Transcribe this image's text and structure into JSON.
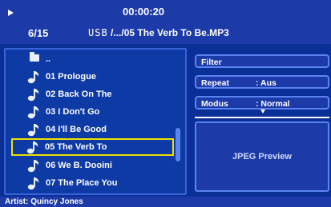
{
  "header": {
    "time": "00:00:20",
    "counter": "6/15",
    "device": "USB",
    "path": "/.../05 The Verb To Be.MP3"
  },
  "list": {
    "items": [
      {
        "label": "..",
        "icon": "folder-icon"
      },
      {
        "label": "01 Prologue",
        "icon": "music-note-icon"
      },
      {
        "label": "02 Back On The",
        "icon": "music-note-icon"
      },
      {
        "label": "03 I Don't Go",
        "icon": "music-note-icon"
      },
      {
        "label": "04 I'll Be Good",
        "icon": "music-note-icon"
      },
      {
        "label": "05 The Verb To",
        "icon": "music-note-icon",
        "selected": true
      },
      {
        "label": "06 We B. Dooini",
        "icon": "music-note-icon"
      },
      {
        "label": "07 The Place You",
        "icon": "music-note-icon"
      }
    ]
  },
  "side": {
    "filter_label": "Filter",
    "repeat_label": "Repeat",
    "repeat_value": ": Aus",
    "modus_label": "Modus",
    "modus_value": ": Normal",
    "preview_label": "JPEG Preview"
  },
  "footer": {
    "artist": "Artist: Quincy Jones"
  },
  "colors": {
    "background": "#0a2f96",
    "panel": "#1c3aa8",
    "border": "#5c84f0",
    "selection": "#f0e000"
  }
}
